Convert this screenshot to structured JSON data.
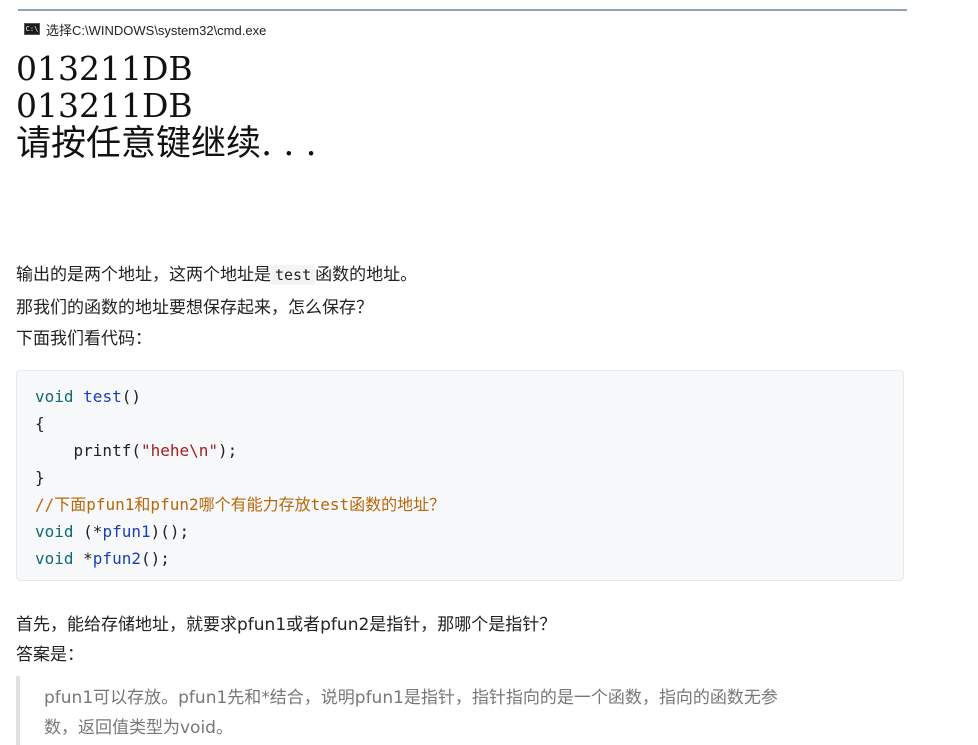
{
  "window": {
    "icon_label": "C:\\",
    "title": "选择C:\\WINDOWS\\system32\\cmd.exe"
  },
  "console": {
    "lines": [
      "013211DB",
      "013211DB",
      "请按任意键继续. . ."
    ]
  },
  "intro": {
    "line1_before": "输出的是两个地址，这两个地址是",
    "line1_code": "test",
    "line1_after": "函数的地址。",
    "line2": "那我们的函数的地址要想保存起来，怎么保存？",
    "line3": "下面我们看代码："
  },
  "code": {
    "l1_kw": "void",
    "l1_fn": "test",
    "l1_rest": "()",
    "l2": "{",
    "l3_pre": "    printf(",
    "l3_str": "\"hehe\\n\"",
    "l3_post": ");",
    "l4": "}",
    "l5": "//下面pfun1和pfun2哪个有能力存放test函数的地址？",
    "l6_kw": "void",
    "l6_a": " (*",
    "l6_name": "pfun1",
    "l6_b": ")();",
    "l7_kw": "void",
    "l7_a": " *",
    "l7_name": "pfun2",
    "l7_b": "();"
  },
  "after": {
    "line1": "首先，能给存储地址，就要求pfun1或者pfun2是指针，那哪个是指针？",
    "line2": "答案是："
  },
  "blockquote": {
    "line1": "pfun1可以存放。pfun1先和*结合，说明pfun1是指针，指针指向的是一个函数，指向的函数无参",
    "line2": "数，返回值类型为void。"
  }
}
